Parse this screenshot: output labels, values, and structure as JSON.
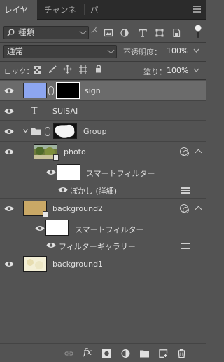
{
  "tabs": [
    {
      "label": "レイヤー",
      "active": true
    },
    {
      "label": "チャンネル",
      "active": false
    },
    {
      "label": "パス",
      "active": false
    }
  ],
  "filter": {
    "kind_label": "種類",
    "filter_icons": [
      "image-filter-icon",
      "adjustment-filter-icon",
      "text-filter-icon",
      "shape-filter-icon",
      "smartobject-filter-icon"
    ],
    "toggle_icon": "filter-toggle-icon"
  },
  "blend": {
    "mode": "通常",
    "opacity_label": "不透明度：",
    "opacity_value": "100%"
  },
  "lock": {
    "label": "ロック：",
    "icons": [
      "lock-transparent-icon",
      "lock-paint-icon",
      "lock-move-icon",
      "lock-artboard-icon",
      "lock-all-icon"
    ],
    "fill_label": "塗り：",
    "fill_value": "100%"
  },
  "layers": [
    {
      "name": "sign",
      "type": "masked",
      "selected": true
    },
    {
      "name": "SUISAI",
      "type": "text"
    },
    {
      "name": "Group",
      "type": "group"
    },
    {
      "name": "photo",
      "type": "smart"
    },
    {
      "name": "スマートフィルター",
      "type": "smartfilter"
    },
    {
      "name": "ぼかし (詳細)",
      "type": "filter"
    },
    {
      "name": "background2",
      "type": "smart"
    },
    {
      "name": "スマートフィルター",
      "type": "smartfilter"
    },
    {
      "name": "フィルターギャラリー",
      "type": "filter"
    },
    {
      "name": "background1",
      "type": "pixel"
    }
  ],
  "footer_icons": [
    "link-layers-icon",
    "fx-icon",
    "add-mask-icon",
    "adjustment-layer-icon",
    "new-group-icon",
    "new-layer-icon",
    "delete-icon"
  ],
  "footer_fx_label": "fx",
  "colors": {
    "panel_bg": "#535353",
    "selected_bg": "#6b6b6b",
    "sign_thumb": "#8da6f0",
    "bg2_thumb": "#c9a866",
    "bg1_thumb": "#f3efd6"
  }
}
